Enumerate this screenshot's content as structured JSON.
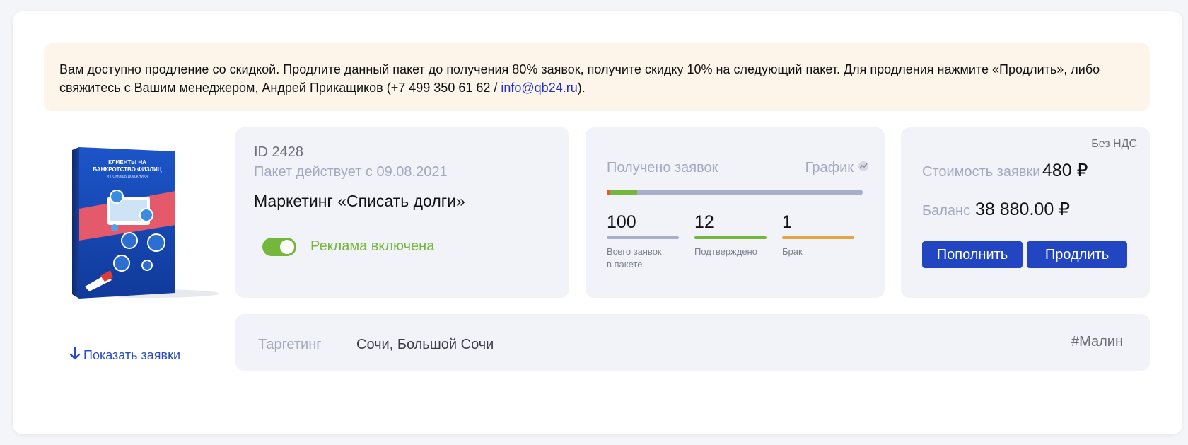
{
  "notice": {
    "text_before": "Вам доступно продление со скидкой. Продлите данный пакет до получения 80% заявок, получите скидку 10% на следующий пакет. Для продления нажмите «Продлить», либо свяжитесь с Вашим менеджером, Андрей Прикащиков (+7 499 350 61 62 / ",
    "email": "info@qb24.ru",
    "text_after": ")."
  },
  "product": {
    "box_title_line1": "КЛИЕНТЫ НА",
    "box_title_line2": "БАНКРОТСТВО ФИЗЛИЦ",
    "box_subtitle": "И ПОМОЩЬ ДОЛЖНИКА",
    "show_requests": "Показать заявки"
  },
  "package": {
    "id": "ID 2428",
    "since": "Пакет действует с 09.08.2021",
    "name": "Маркетинг «Списать долги»",
    "ad_enabled": true,
    "ad_label": "Реклама включена"
  },
  "requests": {
    "title": "Получено заявок",
    "graph_label": "График",
    "progress": 0.12,
    "stats": [
      {
        "value": "100",
        "caption_line1": "Всего заявок",
        "caption_line2": "в пакете",
        "color": "#a9afcb"
      },
      {
        "value": "12",
        "caption_line1": "Подтверждено",
        "caption_line2": "",
        "color": "#75b63d"
      },
      {
        "value": "1",
        "caption_line1": "Брак",
        "caption_line2": "",
        "color": "#e8a545"
      }
    ]
  },
  "billing": {
    "vat": "Без НДС",
    "cost_label": "Стоимость заявки",
    "cost_value": "480 ₽",
    "balance_label": "Баланс",
    "balance_value": "38 880.00 ₽",
    "topup_button": "Пополнить",
    "extend_button": "Продлить"
  },
  "targeting": {
    "label": "Таргетинг",
    "value": "Сочи, Большой Сочи",
    "tag": "#Малин"
  },
  "colors": {
    "accent_blue": "#2245c1",
    "green": "#75b63d",
    "notice_bg": "#fdf4ea",
    "panel_bg": "#f1f3f8"
  }
}
